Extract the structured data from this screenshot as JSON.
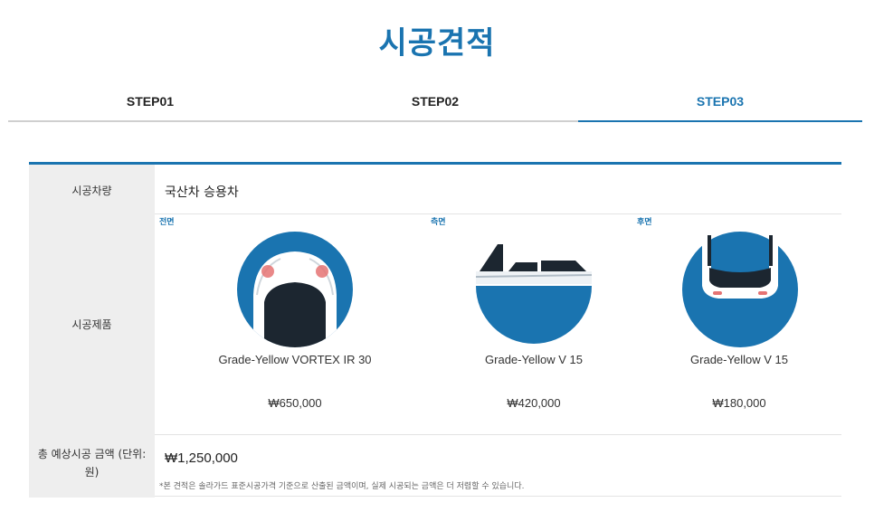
{
  "page": {
    "title": "시공견적"
  },
  "steps": [
    {
      "label": "STEP01",
      "active": false
    },
    {
      "label": "STEP02",
      "active": false
    },
    {
      "label": "STEP03",
      "active": true
    }
  ],
  "quote": {
    "vehicle_label": "시공차량",
    "vehicle_value": "국산차 승용차",
    "product_label": "시공제품",
    "products": [
      {
        "position": "전면",
        "name": "Grade-Yellow VORTEX IR 30",
        "price": "₩650,000",
        "icon": "front-windshield-icon"
      },
      {
        "position": "측면",
        "name": "Grade-Yellow V 15",
        "price": "₩420,000",
        "icon": "side-window-icon"
      },
      {
        "position": "후면",
        "name": "Grade-Yellow V 15",
        "price": "₩180,000",
        "icon": "rear-window-icon"
      }
    ],
    "total_label": "총 예상시공 금액 (단위: 원)",
    "total_value": "₩1,250,000",
    "note": "*본 견적은 솔라가드 표준시공가격 기준으로 산출된 금액이며, 실제 시공되는 금액은 더 저렴할 수 있습니다."
  },
  "colors": {
    "accent": "#1a74b0",
    "label_bg": "#eeeeee"
  }
}
